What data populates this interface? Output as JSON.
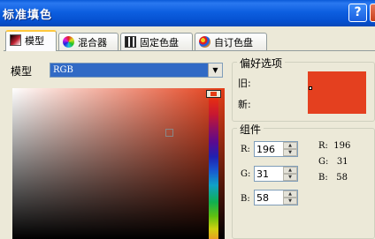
{
  "window": {
    "title": "标准填色"
  },
  "titlebar_buttons": {
    "help": "?",
    "close": "x"
  },
  "tabs": [
    {
      "label": "模型",
      "icon": "color-model-icon"
    },
    {
      "label": "混合器",
      "icon": "color-wheel-icon"
    },
    {
      "label": "固定色盘",
      "icon": "fixed-palette-icon"
    },
    {
      "label": "自订色盘",
      "icon": "custom-palette-icon"
    }
  ],
  "model": {
    "label": "模型",
    "value": "RGB"
  },
  "preferences": {
    "title": "偏好选项",
    "old_label": "旧:",
    "new_label": "新:",
    "color": "#e4401f"
  },
  "components": {
    "title": "组件",
    "r_label": "R:",
    "r_value": "196",
    "g_label": "G:",
    "g_value": "31",
    "b_label": "B:",
    "b_value": "58",
    "ro_r": "R:  196",
    "ro_g": "G:   31",
    "ro_b": "B:   58"
  }
}
